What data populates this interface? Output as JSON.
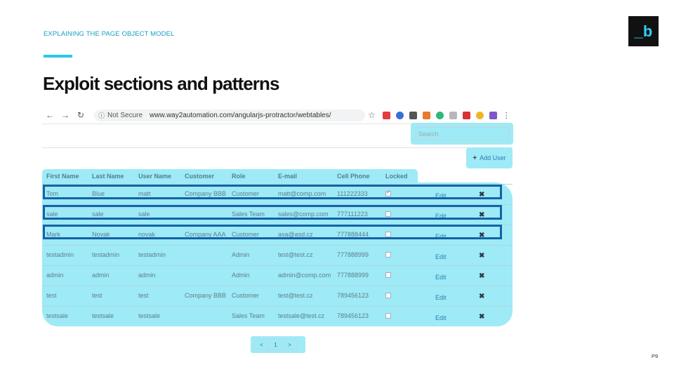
{
  "slide": {
    "eyebrow": "EXPLAINING THE PAGE OBJECT MODEL",
    "title": "Exploit sections and patterns",
    "logo_text": "_b",
    "page_number": "P9",
    "accent_color": "#2cc6ea",
    "highlight_color": "#9eeaf6",
    "row_outline_color": "#1363a6"
  },
  "browser": {
    "back_icon": "←",
    "forward_icon": "→",
    "reload_icon": "↻",
    "info_icon": "ⓘ",
    "security_label": "Not Secure",
    "url": "www.way2automation.com/angularjs-protractor/webtables/",
    "star_icon": "☆",
    "menu_icon": "⋮",
    "extension_colors": [
      "#e23c3c",
      "#3a6fd8",
      "#555555",
      "#e87a2c",
      "#2eb87a",
      "#b8b8b8",
      "#d83232",
      "#f0b429",
      "#7f57c8"
    ]
  },
  "webtable": {
    "search_placeholder": "Search",
    "add_user_icon": "+",
    "add_user_label": "Add User",
    "columns": [
      "First Name",
      "Last Name",
      "User Name",
      "Customer",
      "Role",
      "E-mail",
      "Cell Phone",
      "Locked"
    ],
    "edit_label": "Edit",
    "delete_icon": "✖",
    "rows": [
      {
        "first": "Tom",
        "last": "Blue",
        "user": "matt",
        "customer": "Company BBB",
        "role": "Customer",
        "email": "matt@comp.com",
        "phone": "111222333",
        "locked": true
      },
      {
        "first": "sale",
        "last": "sale",
        "user": "sale",
        "customer": "",
        "role": "Sales Team",
        "email": "sales@comp.com",
        "phone": "777111223",
        "locked": false
      },
      {
        "first": "Mark",
        "last": "Novak",
        "user": "novak",
        "customer": "Company AAA",
        "role": "Customer",
        "email": "asa@asd.cz",
        "phone": "777888444",
        "locked": false
      },
      {
        "first": "testadmin",
        "last": "testadmin",
        "user": "testadmin",
        "customer": "",
        "role": "Admin",
        "email": "test@test.cz",
        "phone": "777888999",
        "locked": false
      },
      {
        "first": "admin",
        "last": "admin",
        "user": "admin",
        "customer": "",
        "role": "Admin",
        "email": "admin@comp.com",
        "phone": "777888999",
        "locked": false
      },
      {
        "first": "test",
        "last": "test",
        "user": "test",
        "customer": "Company BBB",
        "role": "Customer",
        "email": "test@test.cz",
        "phone": "789456123",
        "locked": false
      },
      {
        "first": "testsale",
        "last": "testsale",
        "user": "testsale",
        "customer": "",
        "role": "Sales Team",
        "email": "testsale@test.cz",
        "phone": "789456123",
        "locked": false
      }
    ],
    "pagination": {
      "prev": "<",
      "current": "1",
      "next": ">"
    }
  }
}
